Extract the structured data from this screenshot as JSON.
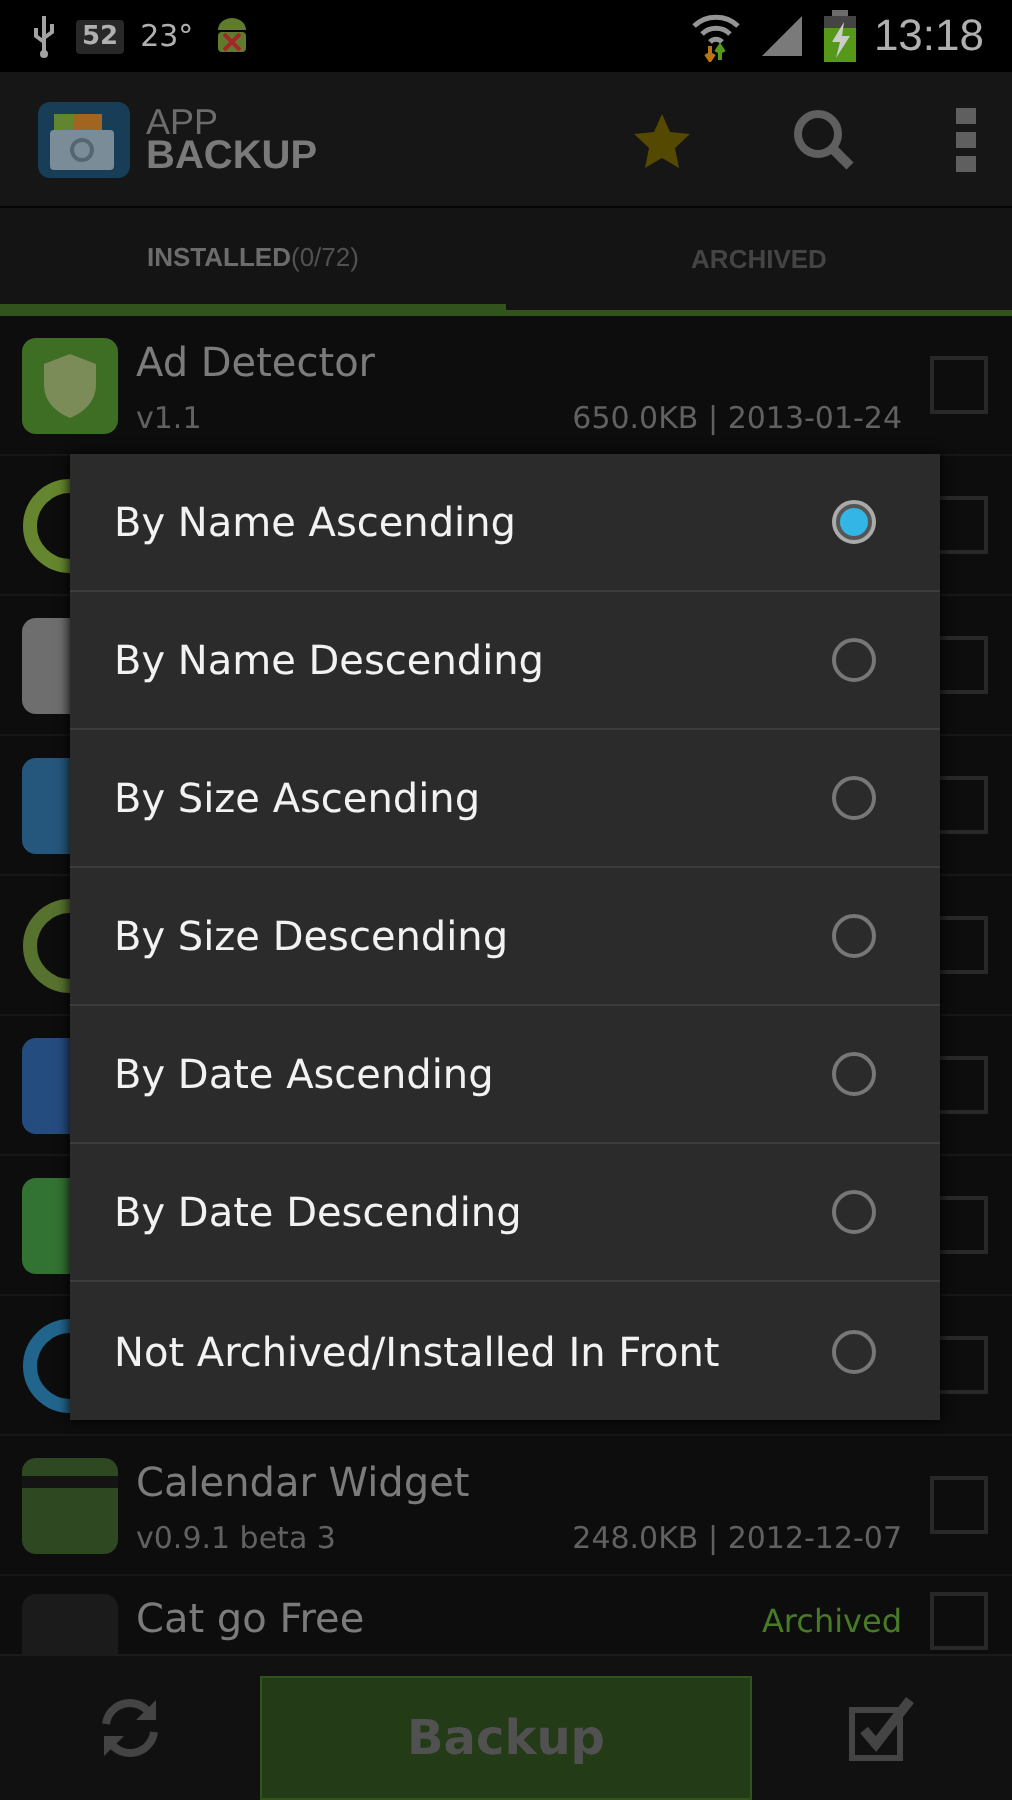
{
  "status_bar": {
    "notification_count": "52",
    "temperature": "23°",
    "time": "13:18"
  },
  "action_bar": {
    "logo_line_1": "APP",
    "logo_line_2": "BACKUP"
  },
  "tabs": [
    {
      "label": "INSTALLED",
      "count": "(0/72)",
      "selected": true
    },
    {
      "label": "ARCHIVED",
      "selected": false
    }
  ],
  "apps": [
    {
      "kind": "full",
      "name": "Ad Detector",
      "version": "v1.1",
      "info": "650.0KB | 2013-01-24",
      "checked": false
    },
    {
      "kind": "hidden",
      "checked": false
    },
    {
      "kind": "hidden",
      "checked": false
    },
    {
      "kind": "hidden",
      "checked": false
    },
    {
      "kind": "hidden",
      "checked": false
    },
    {
      "kind": "hidden",
      "checked": false
    },
    {
      "kind": "hidden",
      "checked": false
    },
    {
      "kind": "hidden",
      "checked": false
    },
    {
      "kind": "full",
      "name": "Calendar Widget",
      "version": "v0.9.1 beta 3",
      "info": "248.0KB | 2012-12-07",
      "checked": false
    },
    {
      "kind": "archived",
      "name": "Cat go Free",
      "status": "Archived",
      "checked": false
    }
  ],
  "sort_dialog": {
    "options": [
      {
        "label": "By Name Ascending",
        "selected": true
      },
      {
        "label": "By Name Descending",
        "selected": false
      },
      {
        "label": "By Size Ascending",
        "selected": false
      },
      {
        "label": "By Size Descending",
        "selected": false
      },
      {
        "label": "By Date Ascending",
        "selected": false
      },
      {
        "label": "By Date Descending",
        "selected": false
      },
      {
        "label": "Not Archived/Installed In Front",
        "selected": false
      }
    ]
  },
  "bottom_bar": {
    "backup_button": "Backup"
  }
}
